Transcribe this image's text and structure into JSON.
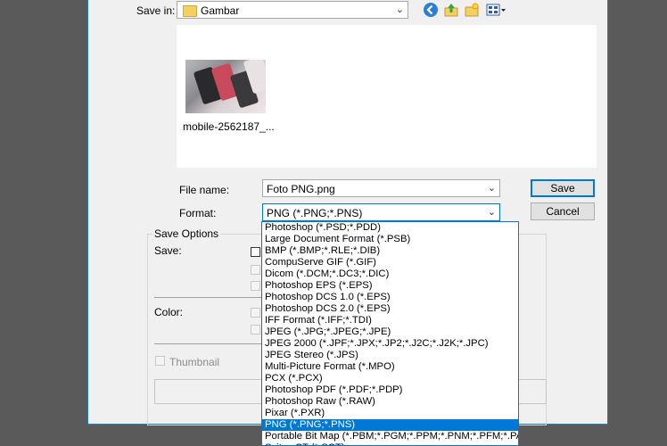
{
  "save_in": {
    "label": "Save in:",
    "value": "Gambar"
  },
  "toolbar": {
    "back": "back-icon",
    "up": "up-folder-icon",
    "new_folder": "new-folder-icon",
    "view_menu": "view-menu-icon"
  },
  "file_list": [
    {
      "name": "mobile-2562187_..."
    }
  ],
  "file_name": {
    "label": "File name:",
    "value": "Foto PNG.png"
  },
  "format": {
    "label": "Format:",
    "value": "PNG (*.PNG;*.PNS)"
  },
  "buttons": {
    "save": "Save",
    "cancel": "Cancel"
  },
  "save_options": {
    "title": "Save Options",
    "save_label": "Save:",
    "color_label": "Color:",
    "thumbnail_label": "Thumbnail"
  },
  "format_options": [
    "Photoshop (*.PSD;*.PDD)",
    "Large Document Format (*.PSB)",
    "BMP (*.BMP;*.RLE;*.DIB)",
    "CompuServe GIF (*.GIF)",
    "Dicom (*.DCM;*.DC3;*.DIC)",
    "Photoshop EPS (*.EPS)",
    "Photoshop DCS 1.0 (*.EPS)",
    "Photoshop DCS 2.0 (*.EPS)",
    "IFF Format (*.IFF;*.TDI)",
    "JPEG (*.JPG;*.JPEG;*.JPE)",
    "JPEG 2000 (*.JPF;*.JPX;*.JP2;*.J2C;*.J2K;*.JPC)",
    "JPEG Stereo (*.JPS)",
    "Multi-Picture Format (*.MPO)",
    "PCX (*.PCX)",
    "Photoshop PDF (*.PDF;*.PDP)",
    "Photoshop Raw (*.RAW)",
    "Pixar (*.PXR)",
    "PNG (*.PNG;*.PNS)",
    "Portable Bit Map (*.PBM;*.PGM;*.PPM;*.PNM;*.PFM;*.PAM)",
    "Scitex CT (*.SCT)"
  ],
  "selected_format_index": 17,
  "colors": {
    "accent": "#0078d7",
    "folder": "#f4cf63"
  }
}
